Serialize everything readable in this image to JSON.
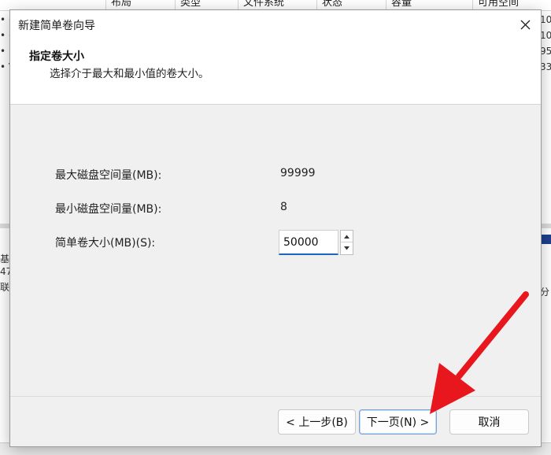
{
  "background": {
    "columns": [
      "布局",
      "类型",
      "文件系统",
      "状态",
      "容量",
      "可用空间"
    ],
    "left_rows": [
      "• (",
      "• (",
      "• D",
      "• V"
    ],
    "right_rows": [
      "10",
      "10",
      "95",
      "33"
    ],
    "lower_left": [
      "基",
      "47",
      "联"
    ],
    "lower_right": "分"
  },
  "dialog": {
    "title": "新建简单卷向导",
    "heading": "指定卷大小",
    "subtitle": "选择介于最大和最小值的卷大小。",
    "fields": {
      "max_label": "最大磁盘空间量(MB):",
      "max_value": "99999",
      "min_label": "最小磁盘空间量(MB):",
      "min_value": "8",
      "size_label": "简单卷大小(MB)(S):",
      "size_value": "50000"
    },
    "buttons": {
      "back": "< 上一步(B)",
      "next": "下一页(N) >",
      "cancel": "取消"
    }
  },
  "icons": {
    "close": "close-icon",
    "spin_up": "chevron-up-icon",
    "spin_down": "chevron-down-icon",
    "annotation": "red-arrow-icon"
  },
  "colors": {
    "accent": "#1a66c2",
    "arrow": "#e8171d",
    "dialog_bg": "#f0f0f0"
  }
}
